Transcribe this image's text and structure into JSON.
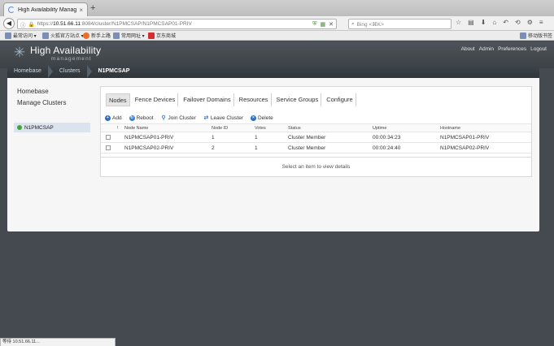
{
  "browser": {
    "tab_title": "High Availability Manageme…",
    "tab_close": "×",
    "new_tab": "+",
    "url_prefix": "https://",
    "url_host": "10.51.66.11",
    "url_rest": ":8084/cluster/N1PMCSAP/N1PMCSAP01-PRIV",
    "search_placeholder": "Bing <⌘K>",
    "bookmarks": [
      "最常访问 ▾",
      "火狐官方站点 ▾",
      "新手上路",
      "常用网址 ▾",
      "京东商城",
      "移动版书签"
    ],
    "status_text": "等待 10.51.66.11..."
  },
  "app": {
    "brand_title": "High Availability",
    "brand_sub": "management",
    "topnav": [
      "About",
      "Admin",
      "Preferences",
      "Logout"
    ],
    "breadcrumb": [
      "Homebase",
      "Clusters",
      "N1PMCSAP"
    ],
    "sidebar": {
      "homebase": "Homebase",
      "manage": "Manage Clusters",
      "cluster": "N1PMCSAP"
    },
    "tabs": [
      "Nodes",
      "Fence Devices",
      "Failover Domains",
      "Resources",
      "Service Groups",
      "Configure"
    ],
    "toolbar": [
      "Add",
      "Reboot",
      "Join Cluster",
      "Leave Cluster",
      "Delete"
    ],
    "table": {
      "headers": [
        "!",
        "Node Name",
        "Node ID",
        "Votes",
        "Status",
        "Uptime",
        "Hostname"
      ],
      "rows": [
        [
          "N1PMCSAP01-PRIV",
          "1",
          "1",
          "Cluster Member",
          "00:00:34:23",
          "N1PMCSAP01-PRIV"
        ],
        [
          "N1PMCSAP02-PRIV",
          "2",
          "1",
          "Cluster Member",
          "00:00:24:40",
          "N1PMCSAP02-PRIV"
        ]
      ]
    },
    "detail_hint": "Select an item to view details"
  }
}
